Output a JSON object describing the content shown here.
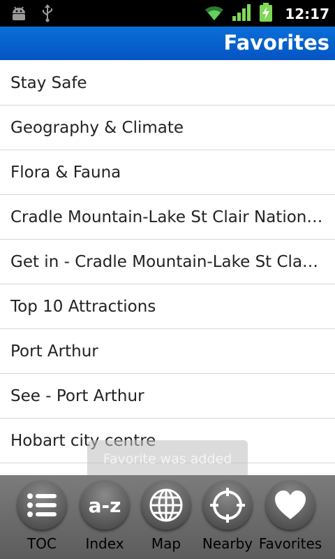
{
  "status": {
    "time": "12:17"
  },
  "header": {
    "title": "Favorites"
  },
  "items": [
    "Stay Safe",
    "Geography & Climate",
    "Flora & Fauna",
    "Cradle Mountain-Lake St Clair Nation…",
    "Get in - Cradle Mountain-Lake St Cla…",
    "Top 10 Attractions",
    "Port Arthur",
    "See - Port Arthur",
    "Hobart city centre"
  ],
  "toast": "Favorite was added",
  "nav": {
    "toc": "TOC",
    "index": "Index",
    "index_icon_text": "a-z",
    "map": "Map",
    "nearby": "Nearby",
    "favorites": "Favorites"
  }
}
